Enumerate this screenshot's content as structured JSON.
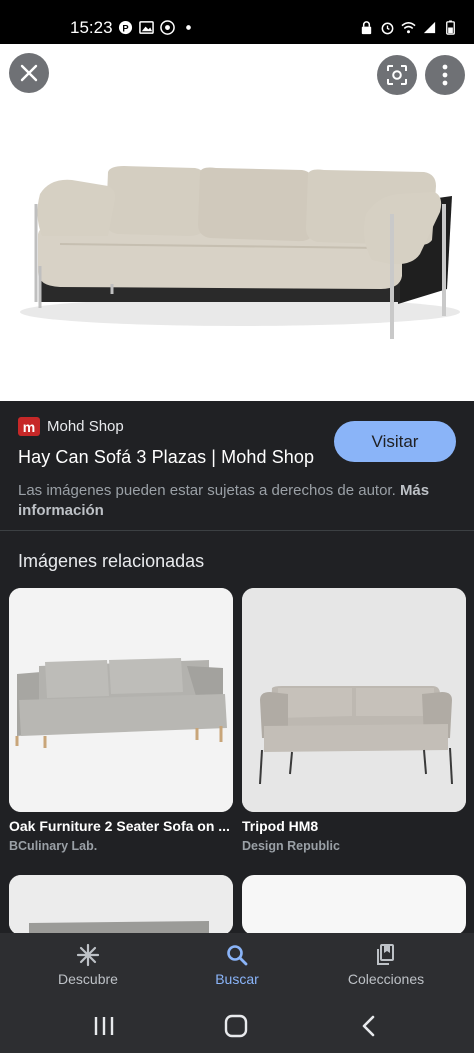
{
  "status_bar": {
    "time": "15:23",
    "left_icons": [
      "pinterest-icon",
      "gallery-icon",
      "chrome-icon",
      "dot-icon"
    ],
    "right_icons": [
      "lock-icon",
      "alarm-icon",
      "wifi-icon",
      "signal-icon",
      "battery-icon"
    ]
  },
  "hero": {
    "close_icon": "close-icon",
    "lens_icon": "lens-icon",
    "more_icon": "more-vert-icon"
  },
  "result": {
    "source_logo_letter": "m",
    "source_name": "Mohd Shop",
    "title": "Hay Can Sofá 3 Plazas | Mohd Shop",
    "visit_label": "Visitar",
    "copyright_text": "Las imágenes pueden estar sujetas a derechos de autor.",
    "more_info_label": "Más información"
  },
  "related": {
    "heading": "Imágenes relacionadas",
    "cards": [
      {
        "caption": "Oak Furniture 2 Seater Sofa on ...",
        "source": "BCulinary Lab."
      },
      {
        "caption": "Tripod HM8",
        "source": "Design Republic"
      }
    ]
  },
  "bottom_nav": {
    "items": [
      {
        "label": "Descubre",
        "icon": "asterisk-icon",
        "active": false
      },
      {
        "label": "Buscar",
        "icon": "search-icon",
        "active": true
      },
      {
        "label": "Colecciones",
        "icon": "collections-icon",
        "active": false
      }
    ]
  },
  "colors": {
    "accent": "#8ab4f8",
    "background": "#202124",
    "source_logo": "#c62828"
  }
}
